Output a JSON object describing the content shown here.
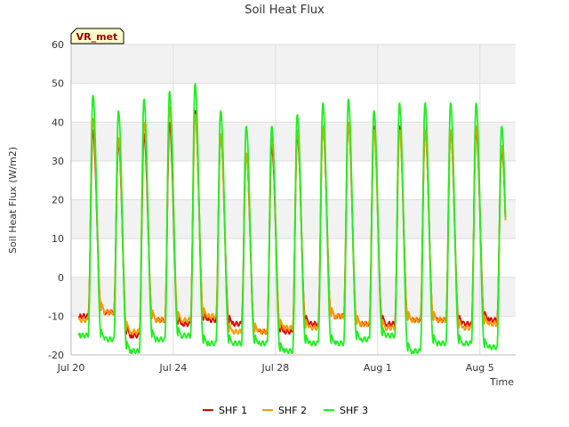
{
  "chart_data": {
    "type": "line",
    "title": "Soil Heat Flux",
    "xlabel": "Time",
    "ylabel": "Soil Heat Flux (W/m2)",
    "badge": "VR_met",
    "x_range_days": [
      0,
      17.4
    ],
    "x_start_day": 0.3,
    "x_end_day": 17.0,
    "x_ticks": [
      {
        "day": 0,
        "label": "Jul 20"
      },
      {
        "day": 4,
        "label": "Jul 24"
      },
      {
        "day": 8,
        "label": "Jul 28"
      },
      {
        "day": 12,
        "label": "Aug 1"
      },
      {
        "day": 16,
        "label": "Aug 5"
      }
    ],
    "ylim": [
      -20,
      60
    ],
    "y_ticks": [
      -20,
      -10,
      0,
      10,
      20,
      30,
      40,
      50,
      60
    ],
    "grid": true,
    "legend_position": "bottom",
    "peak_phase_day": 0.85,
    "series": [
      {
        "name": "SHF 1",
        "color": "#dd0000",
        "peaks": [
          38,
          35,
          37,
          40,
          43,
          37,
          32,
          34,
          37,
          39,
          40,
          39,
          39,
          38,
          38,
          38,
          33
        ],
        "troughs": [
          -10,
          -9,
          -15,
          -11,
          -12,
          -11,
          -12,
          -14,
          -14,
          -12,
          -10,
          -12,
          -12,
          -11,
          -11,
          -12,
          -11,
          -9
        ]
      },
      {
        "name": "SHF 2",
        "color": "#ff9900",
        "peaks": [
          41,
          36,
          40,
          44,
          42,
          37,
          32,
          36,
          38,
          39,
          40,
          38,
          38,
          38,
          38,
          39,
          34
        ],
        "troughs": [
          -11,
          -9,
          -14,
          -11,
          -11,
          -10,
          -14,
          -14,
          -13,
          -13,
          -10,
          -12,
          -13,
          -11,
          -11,
          -13,
          -12,
          -11
        ]
      },
      {
        "name": "SHF 3",
        "color": "#22ee22",
        "peaks": [
          47,
          43,
          46,
          48,
          50,
          43,
          39,
          39,
          42,
          45,
          46,
          43,
          45,
          45,
          45,
          45,
          39
        ],
        "troughs": [
          -15,
          -16,
          -19,
          -16,
          -15,
          -17,
          -17,
          -17,
          -19,
          -17,
          -17,
          -16,
          -15,
          -19,
          -17,
          -17,
          -18,
          -16
        ]
      }
    ]
  }
}
